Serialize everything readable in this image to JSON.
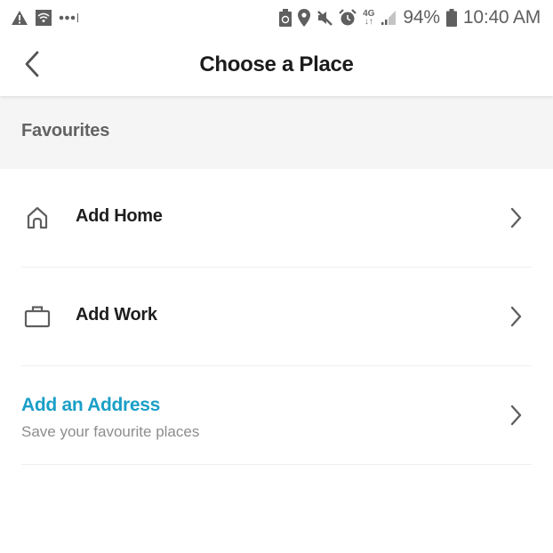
{
  "status_bar": {
    "left_icons": [
      "warning-icon",
      "wifi-icon",
      "more-dots-icon"
    ],
    "right_icons": [
      "battery-saver-icon",
      "location-icon",
      "mute-icon",
      "alarm-icon",
      "network-4g-icon",
      "signal-icon"
    ],
    "network_label": "4G",
    "battery_percent": "94%",
    "time": "10:40 AM"
  },
  "header": {
    "back_icon": "chevron-left-icon",
    "title": "Choose a Place"
  },
  "section": {
    "title": "Favourites"
  },
  "items": [
    {
      "icon": "home-icon",
      "label": "Add Home",
      "chevron": "chevron-right-icon"
    },
    {
      "icon": "briefcase-icon",
      "label": "Add Work",
      "chevron": "chevron-right-icon"
    },
    {
      "label": "Add an Address",
      "sublabel": "Save your favourite places",
      "chevron": "chevron-right-icon"
    }
  ],
  "colors": {
    "accent": "#1a9fc7",
    "section_bg": "#f5f5f5",
    "icon_gray": "#5f5f5f"
  }
}
